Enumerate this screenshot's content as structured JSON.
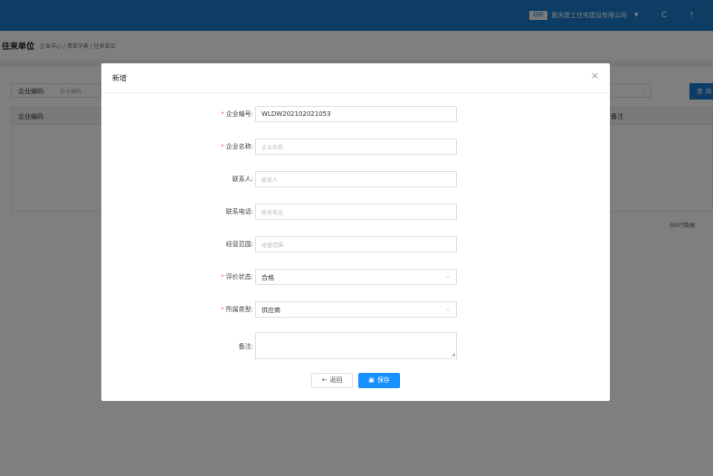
{
  "topbar": {
    "org_badge": "组织",
    "org_name": "重庆建工住宅建设有限公司",
    "caret": "▼",
    "refresh_icon": "C",
    "help_icon": "?"
  },
  "breadcrumb": {
    "title": "往来单位",
    "path": "企业中心 / 清单字典 / 往来单位"
  },
  "background": {
    "search_label": "企业编码:",
    "search_placeholder": "企业编码...",
    "select_chevron": "⌄",
    "query_button": "查 询",
    "table_headers": [
      "企业编码",
      "备注"
    ],
    "total": "共0行数据"
  },
  "dialog": {
    "title": "新增",
    "close": "×",
    "fields": {
      "code": {
        "label": "企业编号:",
        "value": "WLDW202102021053",
        "required": true
      },
      "name": {
        "label": "企业名称:",
        "placeholder": "企业名称",
        "required": true
      },
      "contact": {
        "label": "联系人:",
        "placeholder": "联系人",
        "required": false
      },
      "phone": {
        "label": "联系电话:",
        "placeholder": "联系电话",
        "required": false
      },
      "scope": {
        "label": "经营范围:",
        "placeholder": "经营范围",
        "required": false
      },
      "rating": {
        "label": "评价状态:",
        "value": "合格",
        "required": true
      },
      "type": {
        "label": "所属类型:",
        "value": "供应商",
        "required": true
      },
      "remark": {
        "label": "备注:",
        "required": false
      }
    },
    "required_mark": "*",
    "select_chevron": "⌄",
    "back_icon": "←",
    "back_button": "返回",
    "save_icon": "▣",
    "save_button": "保存"
  },
  "colors": {
    "primary": "#1a78c8",
    "save": "#1890ff",
    "required": "#f56c6c"
  }
}
